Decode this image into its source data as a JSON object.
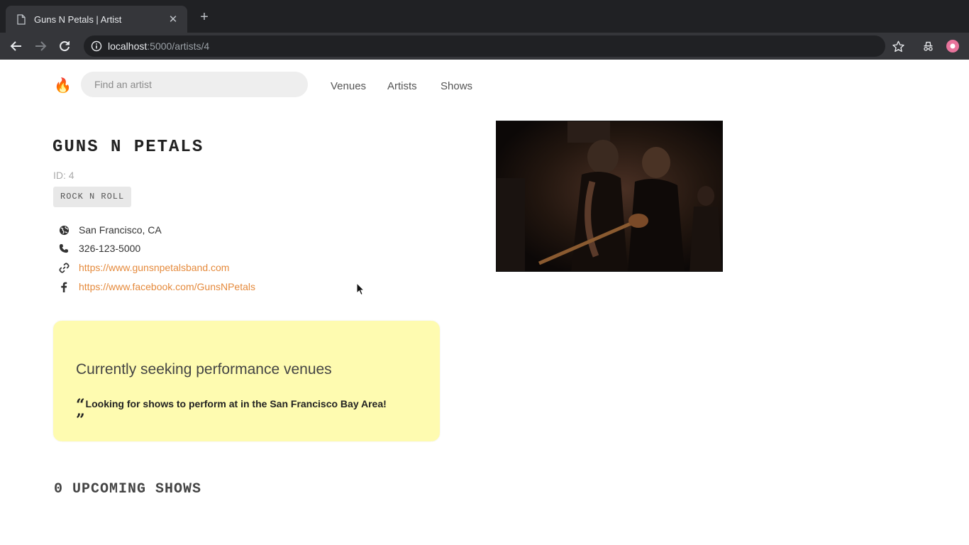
{
  "browser": {
    "tab_title": "Guns N Petals | Artist",
    "tab_close": "✕",
    "new_tab": "+",
    "url_host": "localhost",
    "url_path": ":5000/artists/4"
  },
  "nav": {
    "logo": "🔥",
    "search_placeholder": "Find an artist",
    "links": [
      "Venues",
      "Artists",
      "Shows"
    ]
  },
  "artist": {
    "name": "GUNS N PETALS",
    "id_label": "ID: 4",
    "genres": [
      "ROCK N ROLL"
    ],
    "city": "San Francisco, CA",
    "phone": "326-123-5000",
    "website": "https://www.gunsnpetalsband.com",
    "facebook": "https://www.facebook.com/GunsNPetals",
    "image_description": "band performing on stage with guitar"
  },
  "seeking": {
    "heading": "Currently seeking performance venues",
    "quote_open": "“",
    "quote": "Looking for shows to perform at in the San Francisco Bay Area!",
    "quote_close": "”"
  },
  "shows": {
    "upcoming_heading": "0 UPCOMING SHOWS"
  },
  "colors": {
    "link": "#e58a3c",
    "seeking_bg": "#fefbb0",
    "browser_dark": "#202124",
    "browser_toolbar": "#35363a"
  },
  "icons": {
    "city": "globe-icon",
    "phone": "phone-icon",
    "website": "link-icon",
    "facebook": "facebook-icon"
  }
}
